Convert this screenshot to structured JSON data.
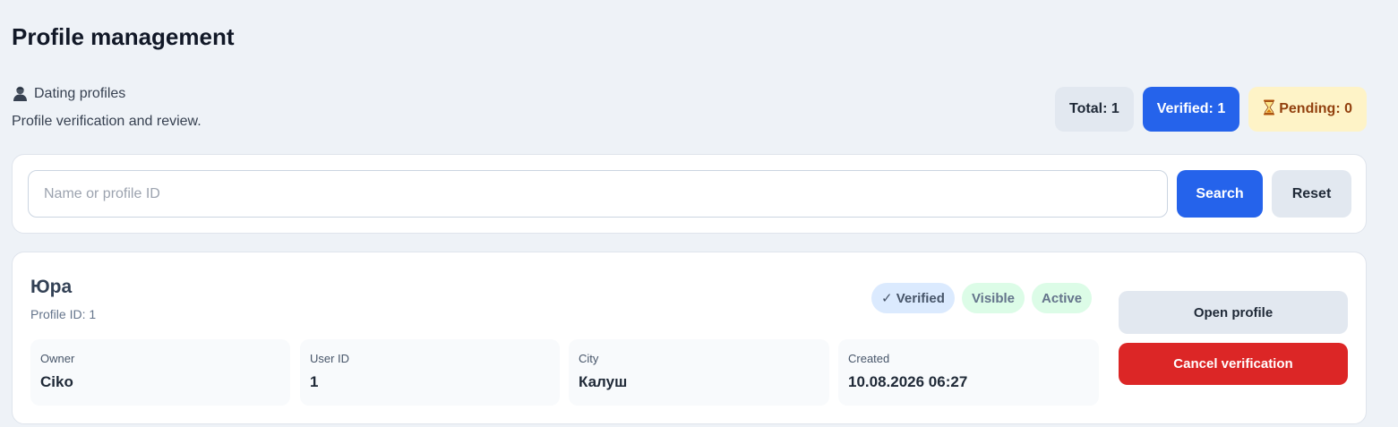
{
  "page": {
    "title": "Profile management"
  },
  "section": {
    "icon": "user-icon",
    "label": "Dating profiles",
    "description": "Profile verification and review."
  },
  "stats": {
    "total": "Total: 1",
    "verified": "Verified: 1",
    "pending_icon": "hourglass-icon",
    "pending": "Pending: 0"
  },
  "search": {
    "placeholder": "Name or profile ID",
    "value": "",
    "search_label": "Search",
    "reset_label": "Reset"
  },
  "profiles": [
    {
      "name": "Юра",
      "profile_id": "Profile ID: 1",
      "badges": [
        "✓ Verified",
        "Visible",
        "Active"
      ],
      "fields": [
        {
          "label": "Owner",
          "value": "Ciko"
        },
        {
          "label": "User ID",
          "value": "1"
        },
        {
          "label": "City",
          "value": "Калуш"
        },
        {
          "label": "Created",
          "value": "10.08.2026 06:27"
        }
      ],
      "open_label": "Open profile",
      "cancel_label": "Cancel verification"
    }
  ],
  "colors": {
    "primary": "#2563eb",
    "danger": "#dc2626",
    "pending_bg": "#fef3c7",
    "pending_text": "#92400e",
    "verified_badge_bg": "#dbeafe",
    "status_badge_bg": "#dcfce7"
  }
}
